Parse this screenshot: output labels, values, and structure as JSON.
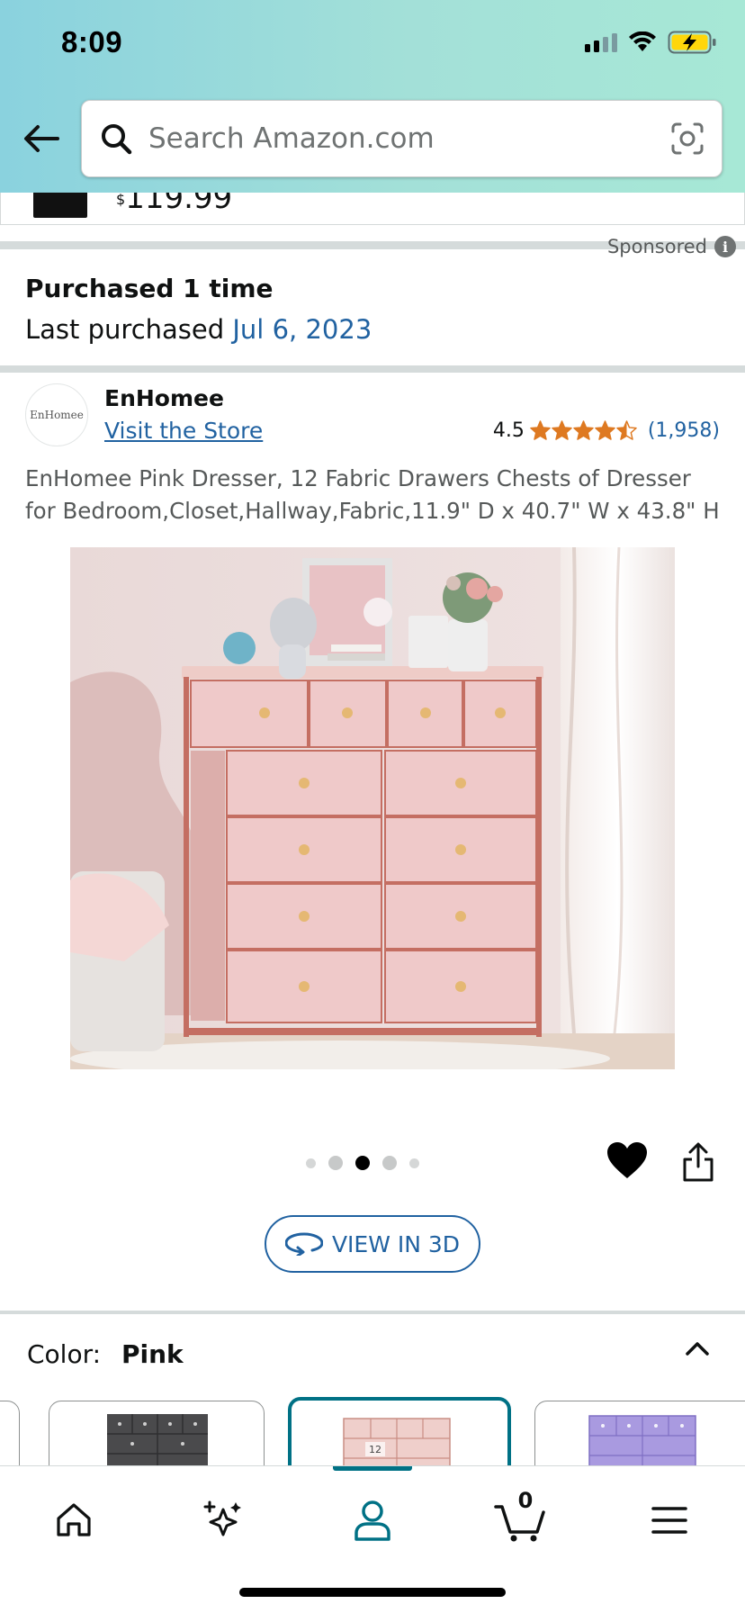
{
  "status_bar": {
    "time": "8:09"
  },
  "search": {
    "placeholder": "Search Amazon.com"
  },
  "previous_item": {
    "price_symbol": "$",
    "price": "119.99"
  },
  "sponsored": {
    "label": "Sponsored",
    "info_glyph": "i"
  },
  "purchase_history": {
    "count_text": "Purchased 1 time",
    "last_label": "Last purchased",
    "last_date": "Jul 6, 2023"
  },
  "store": {
    "logo_text": "EnHomee",
    "brand": "EnHomee",
    "visit_link": "Visit the Store"
  },
  "rating": {
    "value": "4.5",
    "stars": 4.5,
    "count": "(1,958)",
    "star_color": "#de7921"
  },
  "product": {
    "title": "EnHomee Pink Dresser, 12 Fabric Drawers Chests of Dresser for Bedroom,Closet,Hallway,Fabric,11.9\" D x 40.7\" W x 43.8\" H",
    "image_count": 5,
    "image_active_index": 2,
    "drawer_label": "12"
  },
  "buttons": {
    "view_3d": "VIEW IN 3D"
  },
  "variation": {
    "label": "Color:",
    "selected": "Pink",
    "swatches": [
      "Black",
      "Pink",
      "Purple"
    ]
  },
  "bottom_nav": {
    "items": [
      "home-icon",
      "ai-sparkle-icon",
      "account-icon",
      "cart-icon",
      "menu-icon"
    ],
    "active": "account-icon",
    "cart_count": "0"
  },
  "colors": {
    "link": "#2162a1",
    "accent": "#007185",
    "star": "#de7921"
  }
}
